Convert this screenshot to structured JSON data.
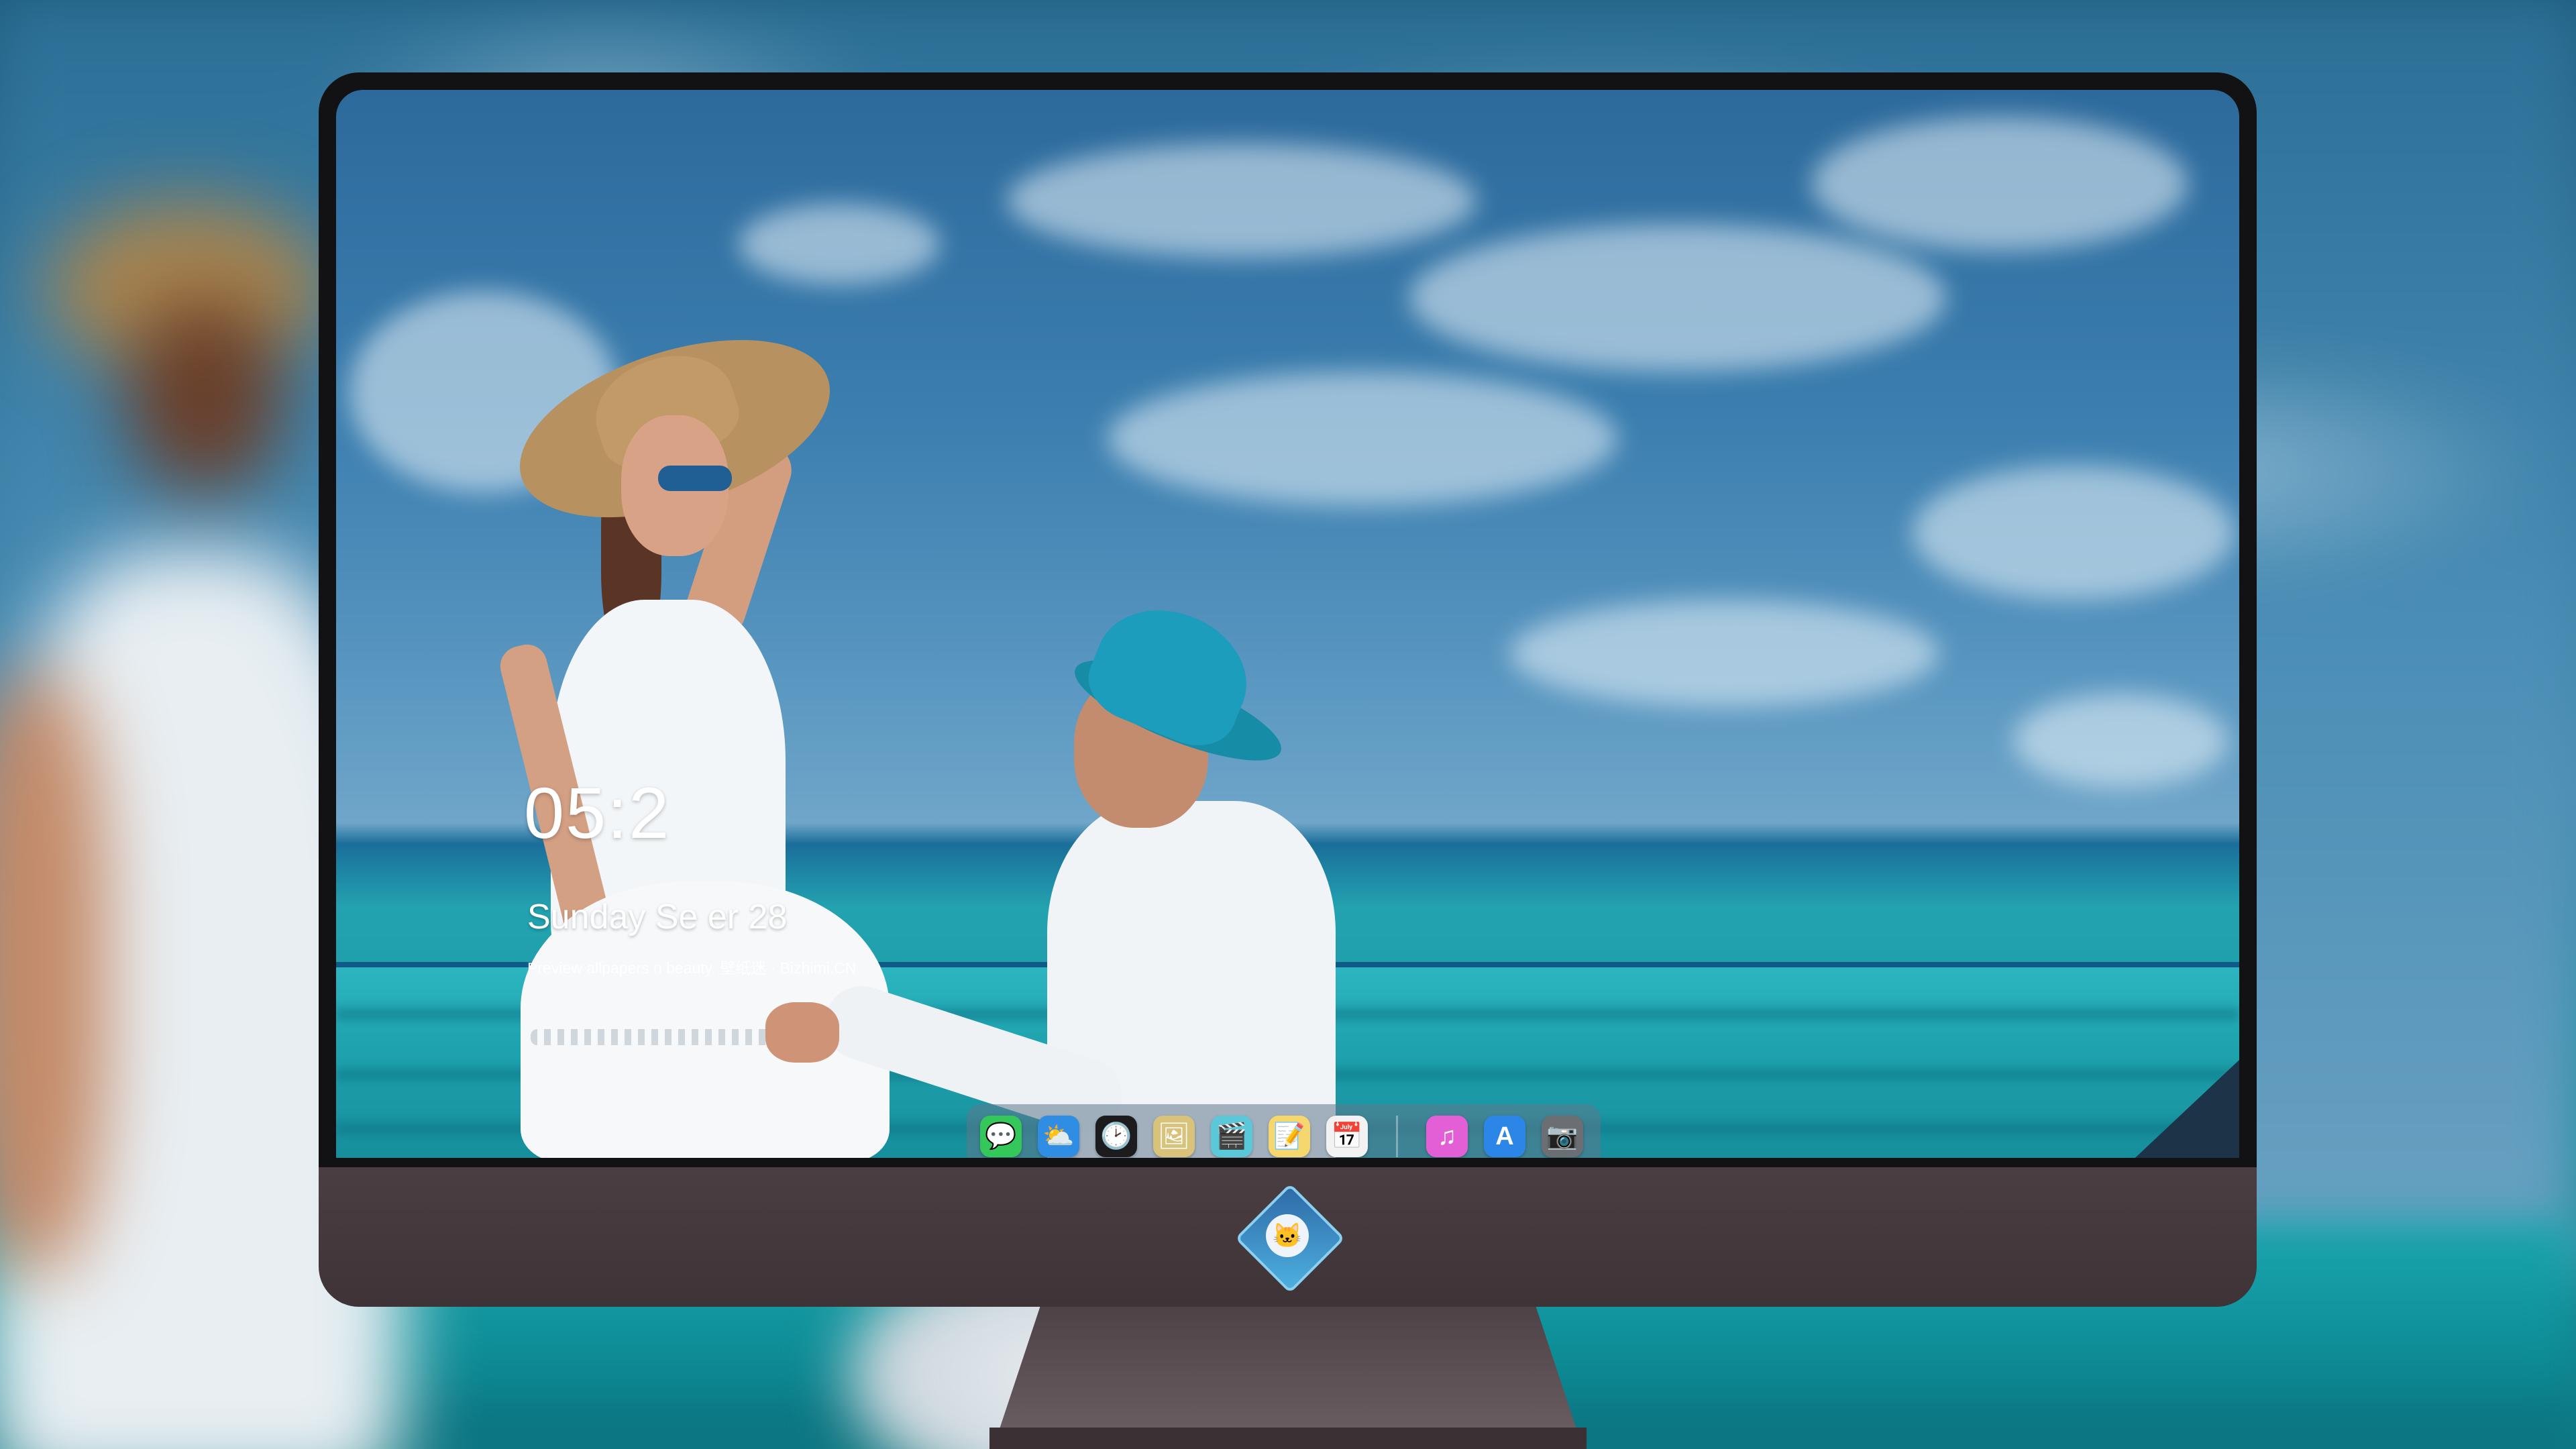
{
  "lock_screen": {
    "time": "05:2",
    "date": "Sunday Se      er  28",
    "caption": "Preview              allpapers                                    n beauty. 壁纸迷 · Bizhimi.CN"
  },
  "dock": {
    "apps": [
      {
        "name": "messages-icon",
        "glyph": "💬",
        "color": "#34c759"
      },
      {
        "name": "weather-icon",
        "glyph": "⛅",
        "color": "#2f8de4"
      },
      {
        "name": "clock-icon",
        "glyph": "🕑",
        "color": "#1c1c1e"
      },
      {
        "name": "preview-icon",
        "glyph": "🖼",
        "color": "#d9c27a"
      },
      {
        "name": "video-clapper-icon",
        "glyph": "🎬",
        "color": "#5ac8d8"
      },
      {
        "name": "notes-icon",
        "glyph": "📝",
        "color": "#f5d76e"
      },
      {
        "name": "calendar-icon",
        "glyph": "📅",
        "color": "#f2f2f2"
      },
      {
        "name": "music-icon",
        "glyph": "♫",
        "color": "#e35fd6"
      },
      {
        "name": "app-store-icon",
        "glyph": "A",
        "color": "#2b86e8"
      },
      {
        "name": "camera-icon",
        "glyph": "📷",
        "color": "#6b6f74"
      }
    ]
  },
  "brand": {
    "logo_glyph": "🐱",
    "accent": "#4db0e0"
  }
}
